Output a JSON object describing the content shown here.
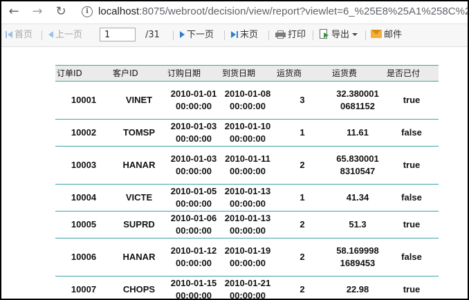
{
  "browser": {
    "url_host": "localhost",
    "url_path": ":8075/webroot/decision/view/report?viewlet=6_%25E8%25A1%258C%2",
    "back_icon": "arrow-left-icon",
    "forward_icon": "arrow-right-icon",
    "reload_icon": "reload-icon",
    "info_icon": "info-icon"
  },
  "toolbar": {
    "first_page": "首页",
    "prev_page": "上一页",
    "page_value": "1",
    "page_total": "/31",
    "next_page": "下一页",
    "last_page": "末页",
    "print": "打印",
    "export": "导出",
    "email": "邮件"
  },
  "table": {
    "headers": [
      "订单ID",
      "客户ID",
      "订购日期",
      "到货日期",
      "运货商",
      "运货费",
      "是否已付"
    ],
    "rows": [
      [
        "10001",
        "VINET",
        "2010-01-01\n00:00:00",
        "2010-01-08\n00:00:00",
        "3",
        "32.380001\n0681152",
        "true"
      ],
      [
        "10002",
        "TOMSP",
        "2010-01-03\n00:00:00",
        "2010-01-10\n00:00:00",
        "1",
        "11.61",
        "false"
      ],
      [
        "10003",
        "HANAR",
        "2010-01-03\n00:00:00",
        "2010-01-11\n00:00:00",
        "2",
        "65.830001\n8310547",
        "true"
      ],
      [
        "10004",
        "VICTE",
        "2010-01-05\n00:00:00",
        "2010-01-13\n00:00:00",
        "1",
        "41.34",
        "false"
      ],
      [
        "10005",
        "SUPRD",
        "2010-01-06\n00:00:00",
        "2010-01-13\n00:00:00",
        "2",
        "51.3",
        "true"
      ],
      [
        "10006",
        "HANAR",
        "2010-01-12\n00:00:00",
        "2010-01-19\n00:00:00",
        "2",
        "58.169998\n1689453",
        "false"
      ],
      [
        "10007",
        "CHOPS",
        "2010-01-15\n00:00:00",
        "2010-01-21\n00:00:00",
        "2",
        "22.98",
        "true"
      ]
    ]
  }
}
